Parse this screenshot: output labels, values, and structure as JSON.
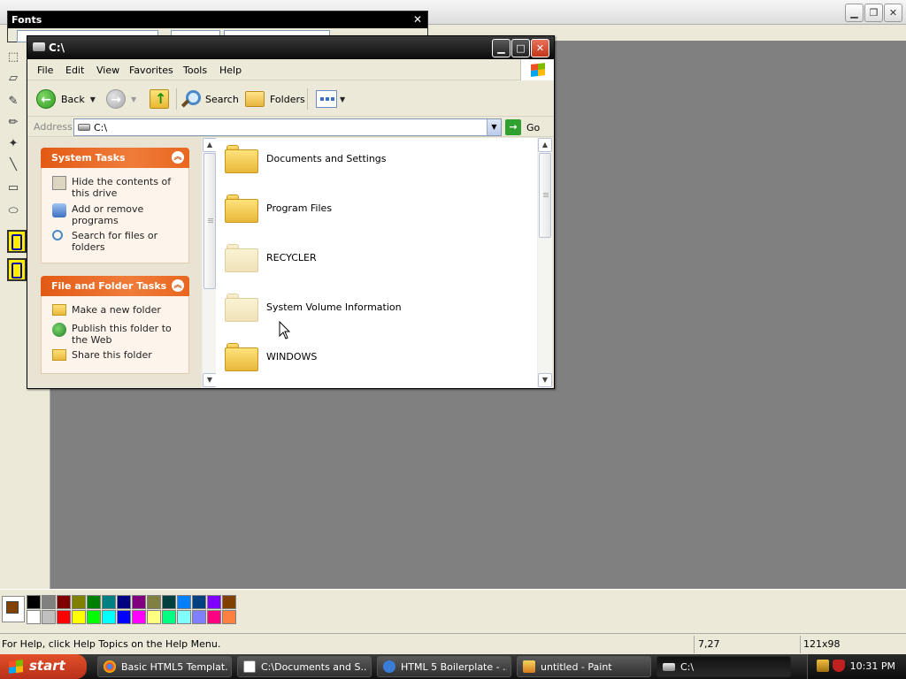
{
  "paint": {
    "title": "",
    "status_help": "For Help, click Help Topics on the Help Menu.",
    "status_coords": "7,27",
    "status_size": "121x98",
    "palette": [
      "#000000",
      "#808080",
      "#800000",
      "#808000",
      "#008000",
      "#008080",
      "#000080",
      "#800080",
      "#808040",
      "#004040",
      "#0080ff",
      "#004080",
      "#8000ff",
      "#804000",
      "#ffffff",
      "#c0c0c0",
      "#ff0000",
      "#ffff00",
      "#00ff00",
      "#00ffff",
      "#0000ff",
      "#ff00ff",
      "#ffff80",
      "#00ff80",
      "#80ffff",
      "#8080ff",
      "#ff0080",
      "#ff8040"
    ],
    "foreground_color": "#804000"
  },
  "fonts_window": {
    "title": "Fonts",
    "close": "✕"
  },
  "explorer": {
    "title": "C:\\",
    "menu": [
      "File",
      "Edit",
      "View",
      "Favorites",
      "Tools",
      "Help"
    ],
    "toolbar": {
      "back": "Back",
      "search": "Search",
      "folders": "Folders"
    },
    "address": {
      "label": "Address",
      "value": "C:\\",
      "go": "Go"
    },
    "system_tasks": {
      "header": "System Tasks",
      "items": [
        {
          "label": "Hide the contents of this drive",
          "icon": "hide-contents-icon"
        },
        {
          "label": "Add or remove programs",
          "icon": "add-remove-programs-icon"
        },
        {
          "label": "Search for files or folders",
          "icon": "search-icon"
        }
      ]
    },
    "file_folder_tasks": {
      "header": "File and Folder Tasks",
      "items": [
        {
          "label": "Make a new folder",
          "icon": "new-folder-icon"
        },
        {
          "label": "Publish this folder to the Web",
          "icon": "globe-icon"
        },
        {
          "label": "Share this folder",
          "icon": "share-folder-icon"
        }
      ]
    },
    "files": [
      {
        "name": "Documents and Settings",
        "hidden": false
      },
      {
        "name": "Program Files",
        "hidden": false
      },
      {
        "name": "RECYCLER",
        "hidden": true
      },
      {
        "name": "System Volume Information",
        "hidden": true
      },
      {
        "name": "WINDOWS",
        "hidden": false
      }
    ]
  },
  "taskbar": {
    "start": "start",
    "buttons": [
      {
        "label": "Basic HTML5 Templat...",
        "icon": "chrome-icon",
        "active": false
      },
      {
        "label": "C:\\Documents and S...",
        "icon": "notepad-icon",
        "active": false
      },
      {
        "label": "HTML 5 Boilerplate - ...",
        "icon": "ie-icon",
        "active": false
      },
      {
        "label": "untitled - Paint",
        "icon": "paint-icon",
        "active": false
      },
      {
        "label": "C:\\",
        "icon": "drive-icon",
        "active": true
      }
    ],
    "clock": "10:31 PM"
  }
}
